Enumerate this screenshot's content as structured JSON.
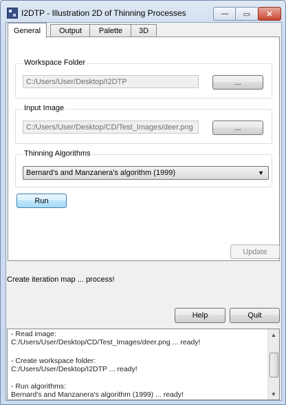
{
  "window": {
    "title": "I2DTP - Illustration 2D of Thinning Processes",
    "min_glyph": "—",
    "max_glyph": "▭",
    "close_glyph": "✕"
  },
  "tabs": [
    {
      "label": "General",
      "active": true
    },
    {
      "label": "Output",
      "active": false
    },
    {
      "label": "Palette",
      "active": false
    },
    {
      "label": "3D",
      "active": false
    }
  ],
  "workspace": {
    "label": "Workspace Folder",
    "value": "C:/Users/User/Desktop/I2DTP",
    "browse_label": "..."
  },
  "input_image": {
    "label": "Input Image",
    "value": "C:/Users/User/Desktop/CD/Test_Images/deer.png",
    "browse_label": "..."
  },
  "algorithms": {
    "label": "Thinning Algorithms",
    "selected": "Bernard's and Manzanera's algorithm (1999)"
  },
  "run_label": "Run",
  "update_label": "Update",
  "status_text": "Create iteration map  ... process!",
  "help_label": "Help",
  "quit_label": "Quit",
  "log_lines": [
    " - Read image:",
    "C:/Users/User/Desktop/CD/Test_Images/deer.png ... ready!",
    "",
    " - Create workspace folder:",
    "C:/Users/User/Desktop/I2DTP ... ready!",
    "",
    " - Run algorithms:",
    "Bernard's and Manzanera's algorithm (1999) ... ready!"
  ],
  "icons": {
    "scroll_up": "▲",
    "scroll_down": "▼",
    "combo_arrow": "▼"
  }
}
